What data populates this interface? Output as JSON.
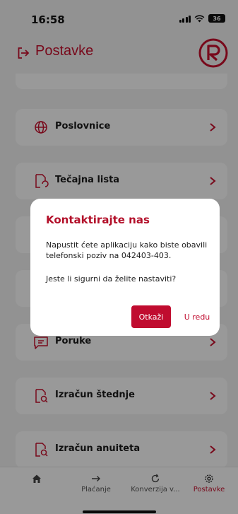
{
  "status_bar": {
    "time": "16:58",
    "battery": "36",
    "icons": [
      "signal-icon",
      "wifi-icon",
      "battery-icon"
    ]
  },
  "header": {
    "title": "Postavke",
    "back_icon": "logout-arrow-icon",
    "logo_letter": "R"
  },
  "colors": {
    "accent": "#c8102e",
    "button": "#c00c2f",
    "card": "#ffffff",
    "background": "#f4f4f4"
  },
  "menu": [
    {
      "label": "Poslovnice",
      "icon": "globe-icon"
    },
    {
      "label": "Tečajna lista",
      "icon": "document-refresh-icon"
    },
    {
      "label": "",
      "icon": "hidden-item-icon"
    },
    {
      "label": "",
      "icon": "hidden-item-icon"
    },
    {
      "label": "Poruke",
      "icon": "message-icon"
    },
    {
      "label": "Izračun štednje",
      "icon": "document-search-icon"
    },
    {
      "label": "Izračun anuiteta",
      "icon": "document-search-icon"
    }
  ],
  "tabs": [
    {
      "label": "",
      "icon": "home-icon"
    },
    {
      "label": "Plaćanje",
      "icon": "arrow-right-icon"
    },
    {
      "label": "Konverzija v...",
      "icon": "refresh-icon"
    },
    {
      "label": "Postavke",
      "icon": "settings-icon"
    }
  ],
  "dialog": {
    "title": "Kontaktirajte nas",
    "message": "Napustit ćete aplikaciju kako biste obavili telefonski poziv na 042403-403.",
    "question": "Jeste li sigurni da želite nastaviti?",
    "cancel_label": "Otkaži",
    "ok_label": "U redu"
  }
}
